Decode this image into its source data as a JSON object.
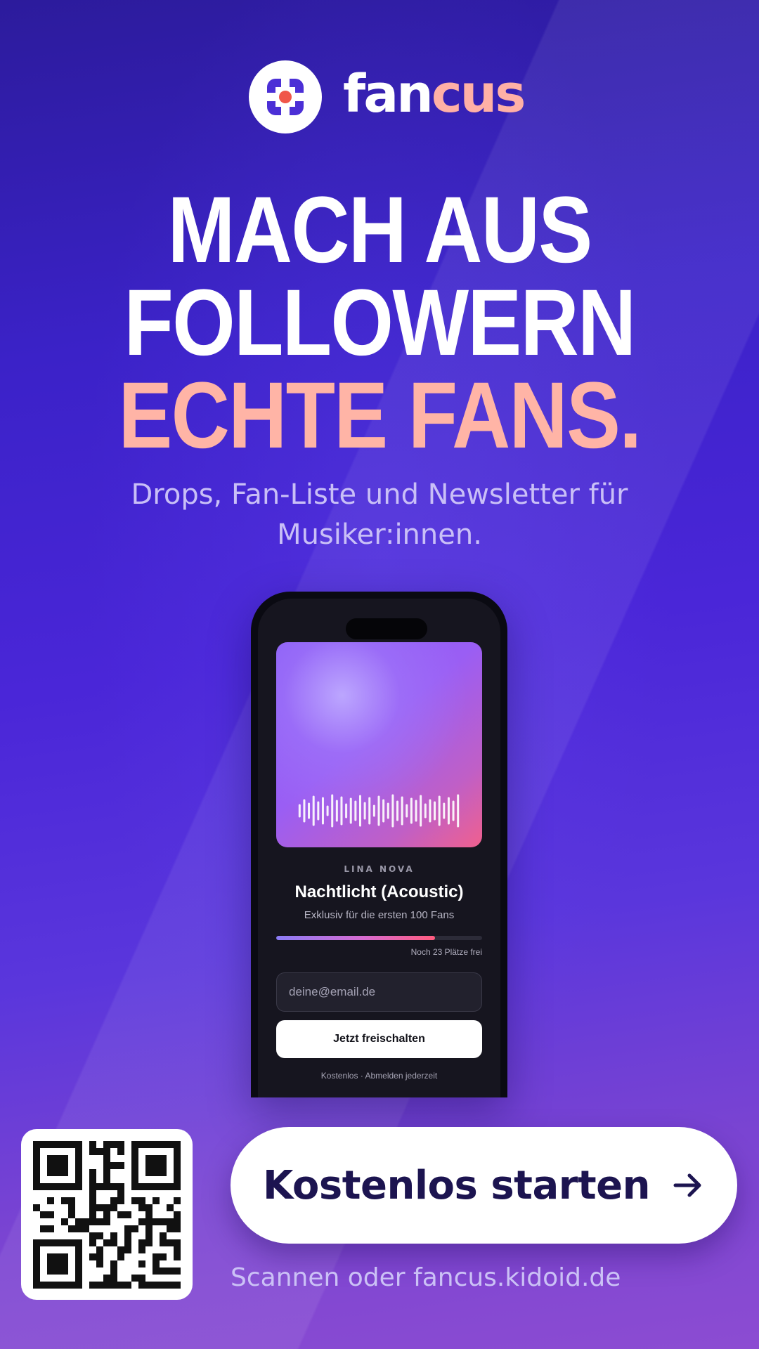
{
  "brand": {
    "name_part1": "fan",
    "name_part2": "cus",
    "logo_icon": "focus-target-icon",
    "accent_color": "#ffb0a6",
    "primary_color": "#4a26d8"
  },
  "headline": {
    "line1": "MACH AUS",
    "line2": "FOLLOWERN",
    "line3": "ECHTE FANS."
  },
  "subline": "Drops, Fan-Liste und Newsletter für Musiker:innen.",
  "phone": {
    "artist": "LINA NOVA",
    "track_title": "Nachtlicht (Acoustic)",
    "exclusive_text": "Exklusiv für die ersten 100 Fans",
    "progress_fraction": 0.77,
    "spots_text": "Noch 23 Plätze frei",
    "email_placeholder": "deine@email.de",
    "unlock_button": "Jetzt freischalten",
    "fine_print": "Kostenlos · Abmelden jederzeit",
    "cover_icon": "audio-waveform-icon"
  },
  "cta": {
    "label": "Kostenlos starten",
    "icon": "arrow-right-icon"
  },
  "qr": {
    "icon": "qr-code-icon"
  },
  "footer": {
    "scan_text": "Scannen oder fancus.kidoid.de"
  }
}
